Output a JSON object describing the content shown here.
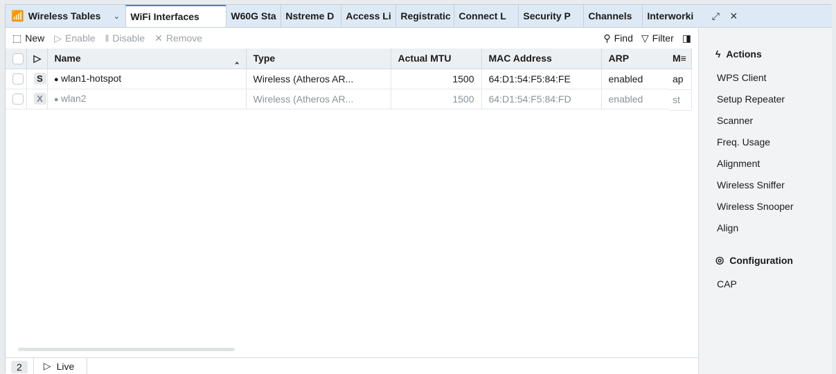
{
  "window": {
    "title": "Wireless Tables",
    "tabs": [
      "WiFi Interfaces",
      "W60G Sta",
      "Nstreme D",
      "Access Li",
      "Registratic",
      "Connect L",
      "Security P",
      "Channels",
      "Interworki"
    ]
  },
  "toolbar": {
    "new": "New",
    "enable": "Enable",
    "disable": "Disable",
    "remove": "Remove",
    "find": "Find",
    "filter": "Filter"
  },
  "table": {
    "columns": [
      "Name",
      "Type",
      "Actual MTU",
      "MAC Address",
      "ARP",
      "M"
    ],
    "rows": [
      {
        "flag": "S",
        "name": "wlan1-hotspot",
        "type": "Wireless (Atheros AR...",
        "mtu": "1500",
        "mac": "64:D1:54:F5:84:FE",
        "arp": "enabled",
        "mode": "ap"
      },
      {
        "flag": "X",
        "name": "wlan2",
        "type": "Wireless (Atheros AR...",
        "mtu": "1500",
        "mac": "64:D1:54:F5:84:FD",
        "arp": "enabled",
        "mode": "st"
      }
    ]
  },
  "status": {
    "count": "2",
    "live": "Live"
  },
  "sidebar": {
    "actions_title": "Actions",
    "actions": [
      "WPS Client",
      "Setup Repeater",
      "Scanner",
      "Freq. Usage",
      "Alignment",
      "Wireless Sniffer",
      "Wireless Snooper",
      "Align"
    ],
    "config_title": "Configuration",
    "config": [
      "CAP"
    ]
  },
  "colors": {
    "tabbar": "#dde9f5",
    "accent": "#3b86d3",
    "sidebar": "#f1f3f5"
  }
}
